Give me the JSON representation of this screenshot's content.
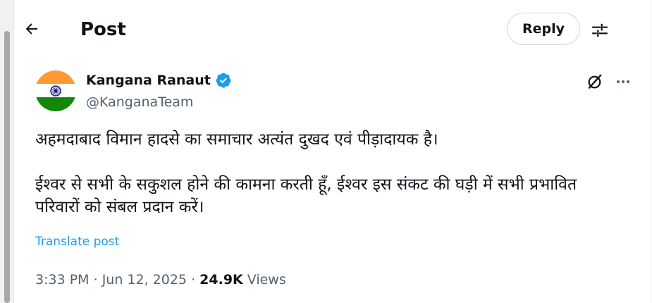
{
  "colors": {
    "text_primary": "#0f1419",
    "text_secondary": "#536471",
    "link": "#1d9bf0",
    "verified_badge": "#1d9bf0",
    "border": "#cfd9de"
  },
  "header": {
    "back_icon": "arrow-left-icon",
    "title": "Post",
    "reply_label": "Reply",
    "settings_icon": "sliders-icon"
  },
  "author": {
    "name": "Kangana Ranaut",
    "handle": "@KanganaTeam",
    "verified_icon": "verified-badge-icon",
    "avatar_icon": "indian-flag-avatar"
  },
  "actions": {
    "grok_icon": "grok-icon",
    "more_icon": "more-horizontal-icon"
  },
  "tweet": {
    "line1": "अहमदाबाद विमान हादसे का समाचार अत्यंत दुखद एवं पीड़ादायक है।",
    "line2": "ईश्वर से सभी के सकुशल होने की कामना करती हूँ, ईश्वर इस संकट की घड़ी में सभी प्रभावित परिवारों को संबल प्रदान करें।",
    "translate_label": "Translate post"
  },
  "meta": {
    "time": "3:33 PM",
    "separator": " · ",
    "date": "Jun 12, 2025",
    "views_count": "24.9K",
    "views_label": " Views"
  }
}
